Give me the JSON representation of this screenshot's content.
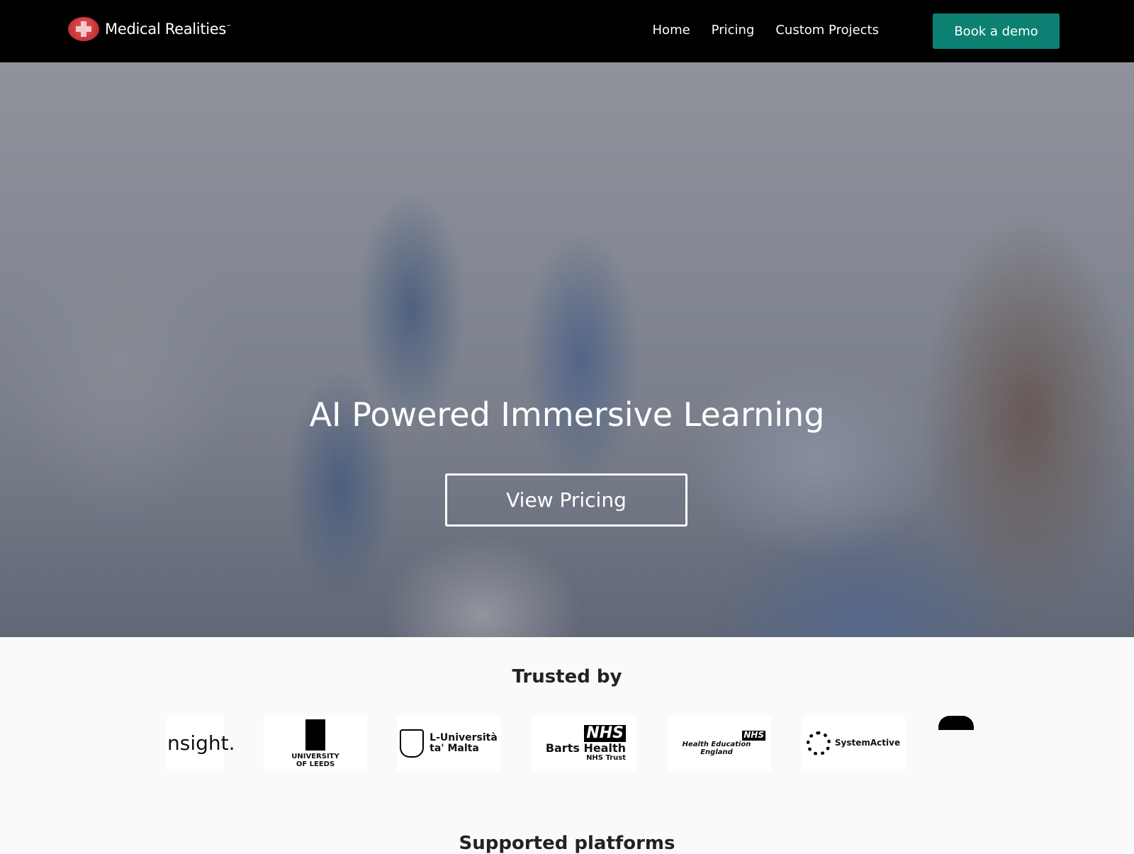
{
  "nav": {
    "brand": "Medical Realities",
    "brand_tm": "™",
    "links": [
      "Home",
      "Pricing",
      "Custom Projects"
    ],
    "cta": "Book a demo",
    "cta_color": "#0d8074"
  },
  "hero": {
    "headline": "AI Powered Immersive Learning",
    "button": "View Pricing"
  },
  "trusted": {
    "title": "Trusted by",
    "logos": [
      {
        "text": "nsight."
      },
      {
        "line1": "UNIVERSITY",
        "line2": "OF LEEDS"
      },
      {
        "line1": "L-Università",
        "line2": "ta' Malta"
      },
      {
        "badge": "NHS",
        "line1": "Barts Health",
        "line2": "NHS Trust"
      },
      {
        "badge": "NHS",
        "line1": "Health Education England"
      },
      {
        "text": "SystemActive"
      }
    ]
  },
  "platforms": {
    "title": "Supported platforms"
  }
}
